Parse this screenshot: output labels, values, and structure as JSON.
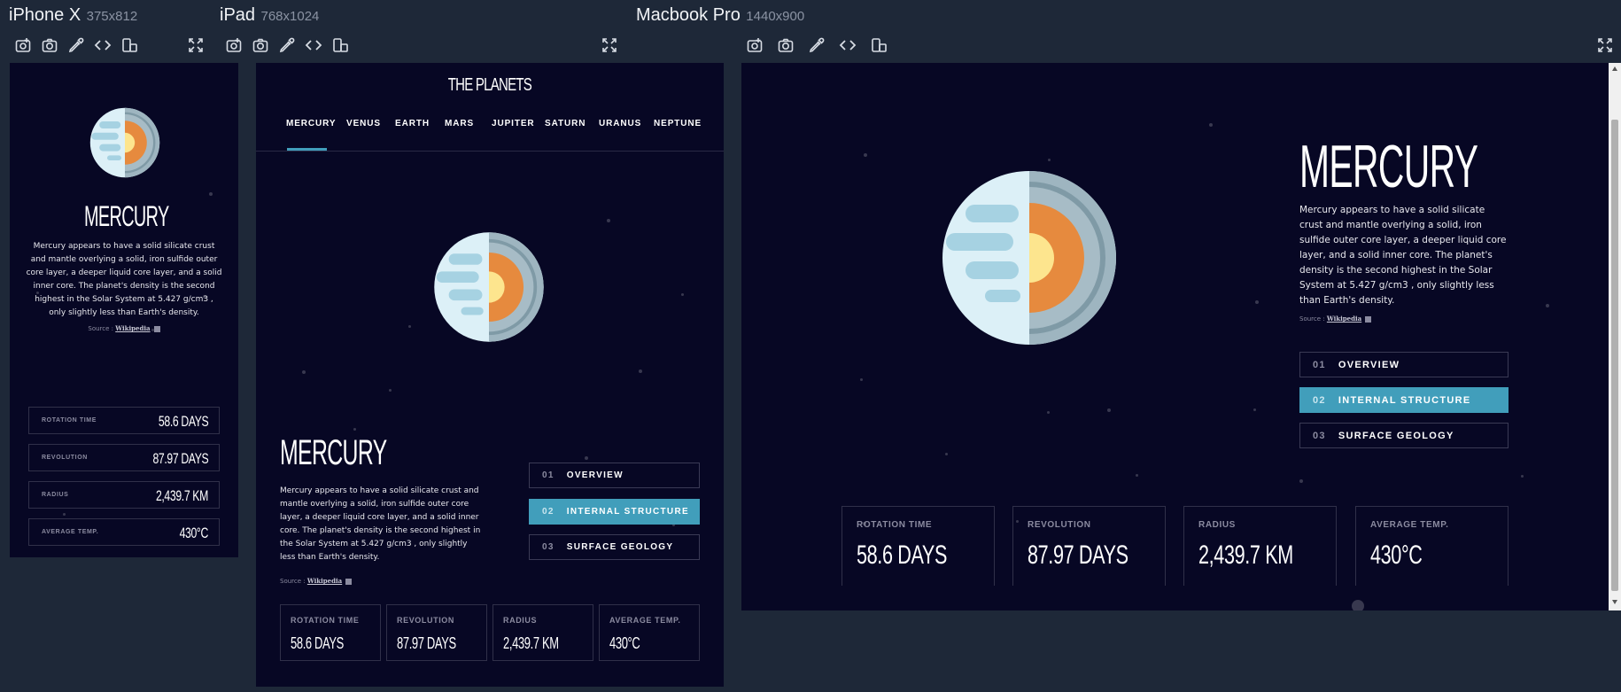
{
  "devices": [
    {
      "name": "iPhone X",
      "size": "375x812"
    },
    {
      "name": "iPad",
      "size": "768x1024"
    },
    {
      "name": "Macbook Pro",
      "size": "1440x900"
    }
  ],
  "toolbar_icons": [
    "screenshot-icon",
    "camera-icon",
    "eyedropper-icon",
    "code-icon",
    "rotate-device-icon",
    "fullscreen-icon"
  ],
  "site": {
    "logo": "THE PLANETS",
    "nav": [
      "MERCURY",
      "VENUS",
      "EARTH",
      "MARS",
      "JUPITER",
      "SATURN",
      "URANUS",
      "NEPTUNE"
    ],
    "active_nav": "MERCURY"
  },
  "planet": {
    "name": "MERCURY",
    "description": "Mercury appears to have a solid silicate crust and mantle overlying a solid, iron sulfide outer core layer, a deeper liquid core layer, and a solid inner core. The planet's density is the second highest in the Solar System at 5.427 g/cm3 , only slightly less than Earth's density.",
    "source_label": "Source :",
    "source_link": "Wikipedia",
    "tabs": [
      {
        "num": "01",
        "label": "OVERVIEW"
      },
      {
        "num": "02",
        "label": "INTERNAL STRUCTURE"
      },
      {
        "num": "03",
        "label": "SURFACE GEOLOGY"
      }
    ],
    "active_tab": "INTERNAL STRUCTURE",
    "stats": [
      {
        "label": "ROTATION TIME",
        "value": "58.6 DAYS"
      },
      {
        "label": "REVOLUTION",
        "value": "87.97 DAYS"
      },
      {
        "label": "RADIUS",
        "value": "2,439.7 KM"
      },
      {
        "label": "AVERAGE TEMP.",
        "value": "430°C"
      }
    ]
  },
  "colors": {
    "page_bg": "#1e2838",
    "frame_bg": "#070724",
    "accent": "#419ebb",
    "planet_surface": "#dcf0f7",
    "planet_spots": "#a6d2e2",
    "mantle": "#9eb5c0",
    "outer_core": "#e68a3e",
    "inner_core": "#fde58e"
  }
}
